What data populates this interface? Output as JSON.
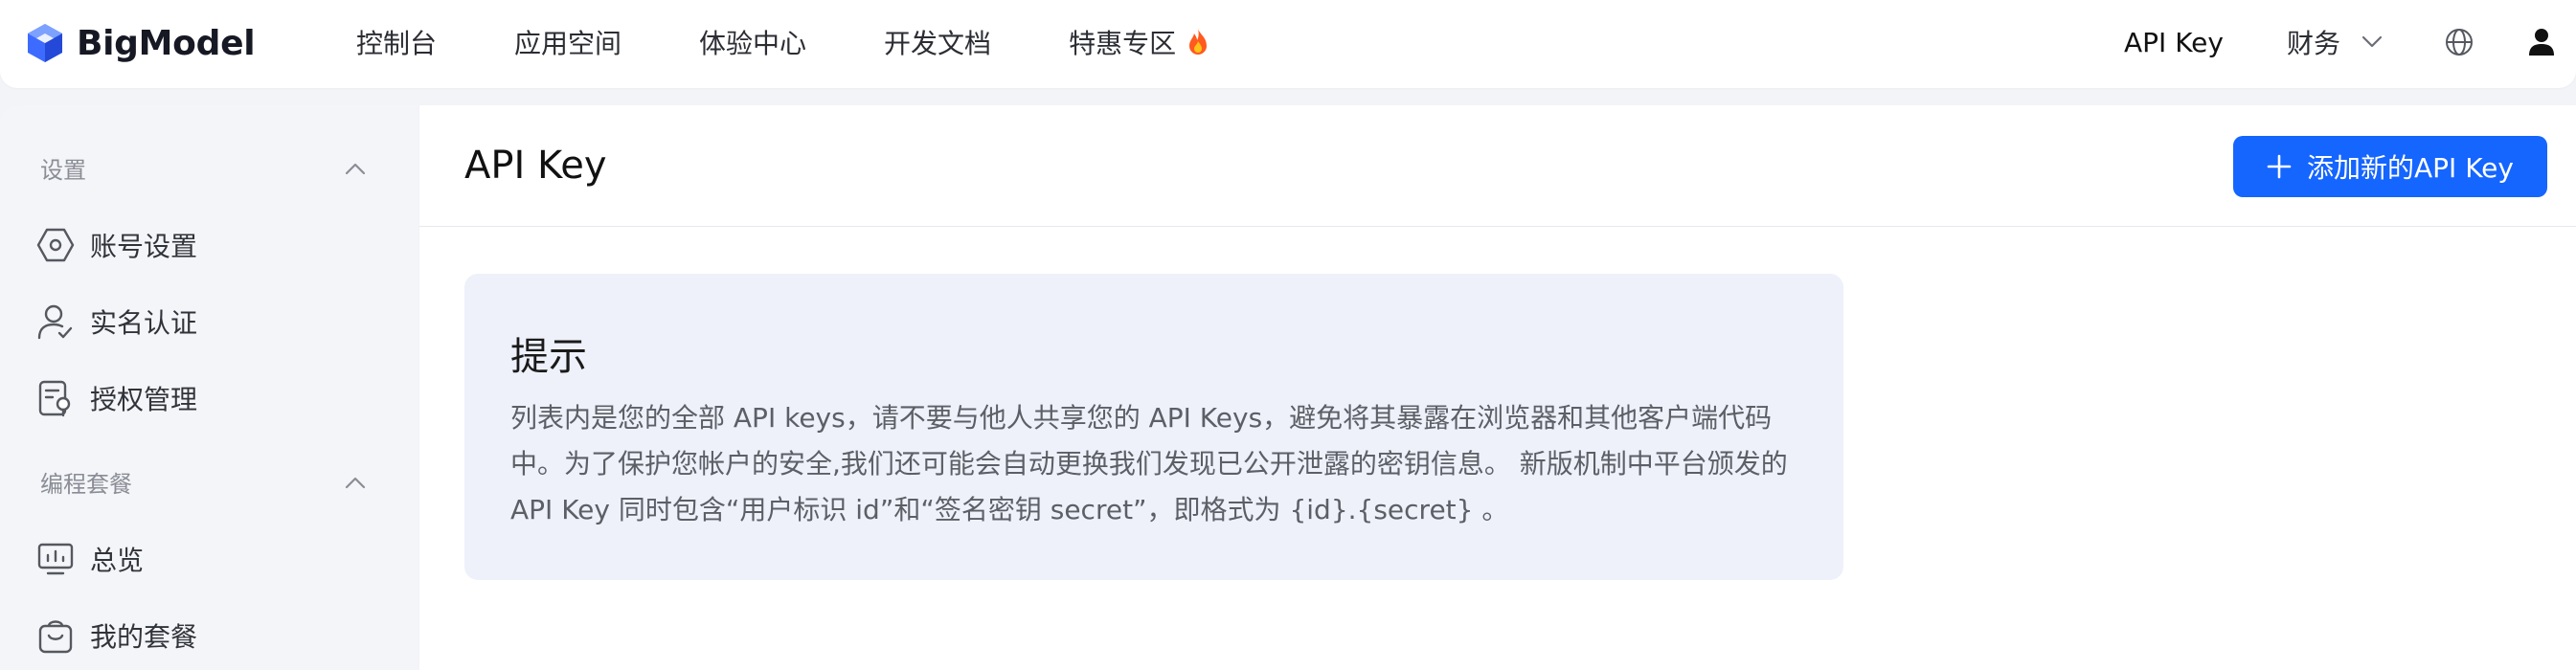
{
  "brand": {
    "name": "BigModel"
  },
  "nav": {
    "items": [
      {
        "label": "控制台"
      },
      {
        "label": "应用空间"
      },
      {
        "label": "体验中心"
      },
      {
        "label": "开发文档"
      },
      {
        "label": "特惠专区",
        "icon": "fire-icon"
      }
    ],
    "api_key_label": "API Key",
    "finance_label": "财务",
    "icons": [
      "chevron-down-icon",
      "globe-icon",
      "user-icon"
    ]
  },
  "sidebar": {
    "groups": [
      {
        "label": "设置",
        "items": [
          {
            "label": "账号设置",
            "icon": "hexagon-settings-icon"
          },
          {
            "label": "实名认证",
            "icon": "user-verify-icon"
          },
          {
            "label": "授权管理",
            "icon": "authorization-icon"
          }
        ]
      },
      {
        "label": "编程套餐",
        "items": [
          {
            "label": "总览",
            "icon": "monitor-chart-icon"
          },
          {
            "label": "我的套餐",
            "icon": "package-icon"
          }
        ]
      }
    ]
  },
  "main": {
    "title": "API Key",
    "add_button_label": "添加新的API Key",
    "tip": {
      "title": "提示",
      "body": "列表内是您的全部 API keys，请不要与他人共享您的 API Keys，避免将其暴露在浏览器和其他客户端代码中。为了保护您帐户的安全,我们还可能会自动更换我们发现已公开泄露的密钥信息。 新版机制中平台颁发的 API Key 同时包含“用户标识 id”和“签名密钥 secret”，即格式为 {id}.{secret} 。"
    }
  },
  "colors": {
    "accent": "#1565ff",
    "tip_background": "#eef1fa",
    "sidebar_background": "#f4f5f8",
    "page_background": "#f3f4f7"
  }
}
